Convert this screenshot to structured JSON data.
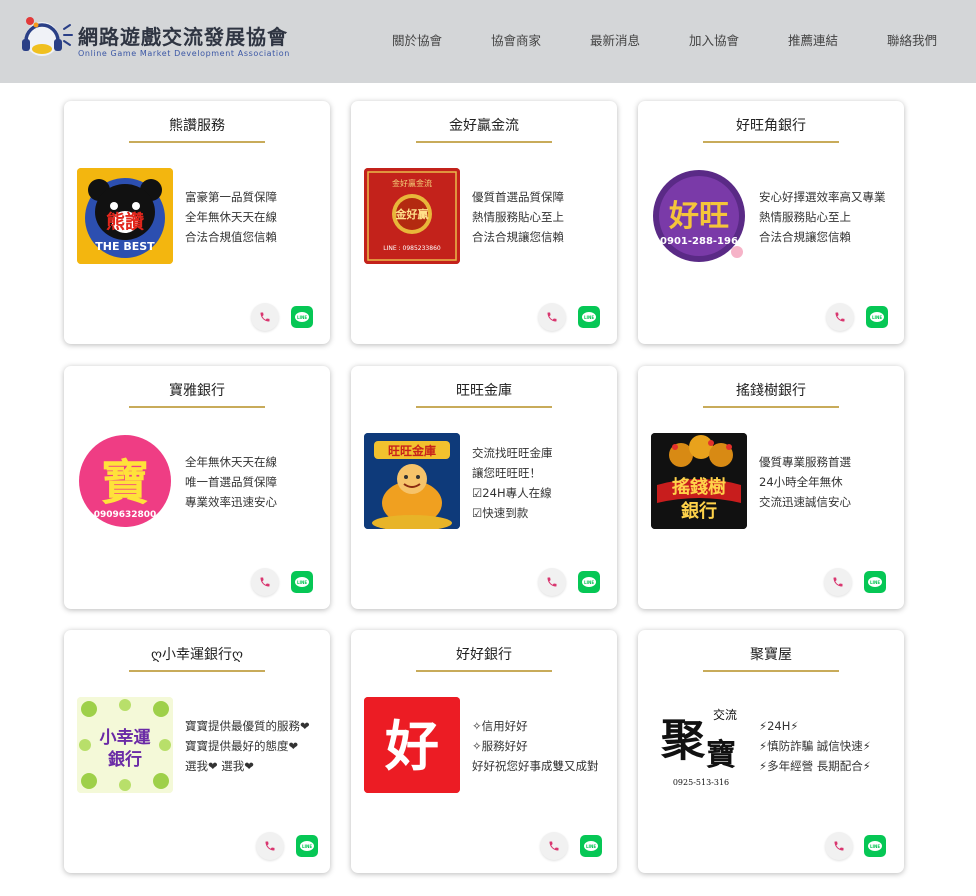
{
  "site": {
    "title": "網路遊戲交流發展協會",
    "subtitle": "Online Game Market Development Association"
  },
  "nav": [
    {
      "label": "關於協會"
    },
    {
      "label": "協會商家"
    },
    {
      "label": "最新消息"
    },
    {
      "label": "加入協會"
    },
    {
      "label": "推薦連結"
    },
    {
      "label": "聯絡我們"
    }
  ],
  "colors": {
    "header_bg": "#d4d6d8",
    "accent_gold": "#c8ab5a",
    "line_green": "#06c755",
    "phone_pink": "#d9366f"
  },
  "cards": [
    {
      "title": "熊讚服務",
      "logo": {
        "text": "熊讚",
        "sub": "THE BEST"
      },
      "lines": [
        "富豪第一品質保障",
        "全年無休天天在線",
        "合法合規值您信賴"
      ]
    },
    {
      "title": "金好贏金流",
      "logo": {
        "text": "金好贏",
        "top": "金好贏金流",
        "sub": "LINE : 0985233860"
      },
      "lines": [
        "優質首選品質保障",
        "熱情服務貼心至上",
        "合法合規讓您信賴"
      ]
    },
    {
      "title": "好旺角銀行",
      "logo": {
        "text": "好旺",
        "sub": "0901-288-196"
      },
      "lines": [
        "安心好擇選效率高又專業",
        "熱情服務貼心至上",
        "合法合規讓您信賴"
      ]
    },
    {
      "title": "寶雅銀行",
      "logo": {
        "text": "寶",
        "sub": "0909632800"
      },
      "lines": [
        "全年無休天天在線",
        "唯一首選品質保障",
        "專業效率迅速安心"
      ]
    },
    {
      "title": "旺旺金庫",
      "logo": {
        "text": "旺旺金庫"
      },
      "lines": [
        "交流找旺旺金庫",
        "讓您旺旺旺！",
        "☑24H專人在線",
        "☑快速到款"
      ]
    },
    {
      "title": "搖錢樹銀行",
      "logo": {
        "text": "搖錢樹",
        "sub": "銀行"
      },
      "lines": [
        "優質專業服務首選",
        "24小時全年無休",
        "交流迅速誠信安心"
      ]
    },
    {
      "title": "ღ小幸運銀行ღ",
      "logo": {
        "text": "小幸運",
        "sub": "銀行"
      },
      "lines": [
        "寶寶提供最優質的服務❤",
        "寶寶提供最好的態度❤",
        "選我❤ 選我❤"
      ]
    },
    {
      "title": "好好銀行",
      "logo": {
        "text": "好"
      },
      "lines": [
        "✧信用好好",
        "✧服務好好",
        "好好祝您好事成雙又成對"
      ]
    },
    {
      "title": "聚寶屋",
      "logo": {
        "text": "聚",
        "text2": "寶",
        "top": "交流",
        "sub": "0925-513-316"
      },
      "lines": [
        "⚡24H⚡",
        "⚡慎防詐騙 誠信快速⚡",
        "⚡多年經營 長期配合⚡"
      ]
    }
  ]
}
